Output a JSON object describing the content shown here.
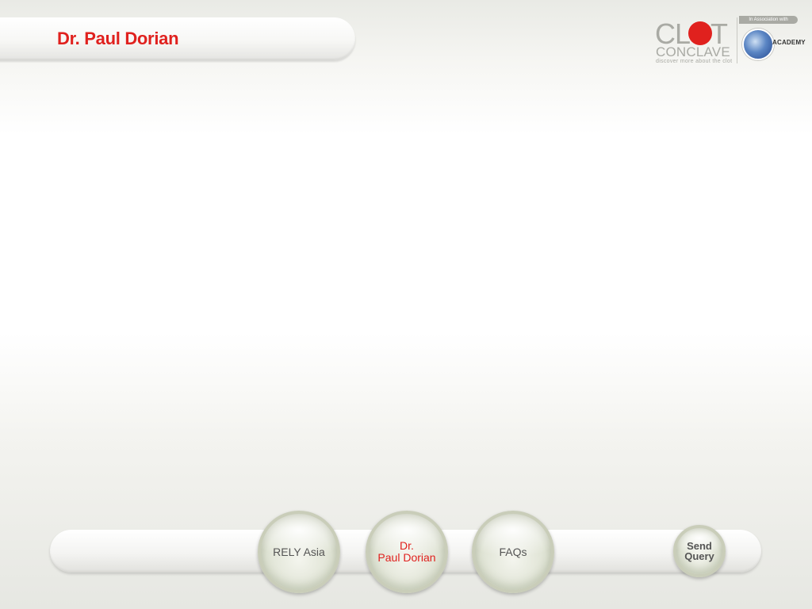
{
  "header": {
    "title": "Dr. Paul Dorian"
  },
  "logo": {
    "clot": "CL",
    "clot_end": "T",
    "conclave": "CONCLAVE",
    "tagline": "discover more about the clot",
    "association": "In Association with",
    "academy": "ACADEMY"
  },
  "nav": {
    "items": [
      {
        "label": "RELY Asia"
      },
      {
        "label_line1": "Dr.",
        "label_line2": "Paul Dorian"
      },
      {
        "label": "FAQs"
      },
      {
        "label_line1": "Send",
        "label_line2": "Query"
      }
    ]
  },
  "colors": {
    "accent": "#e0211e",
    "neutral": "#a9aaa4"
  }
}
